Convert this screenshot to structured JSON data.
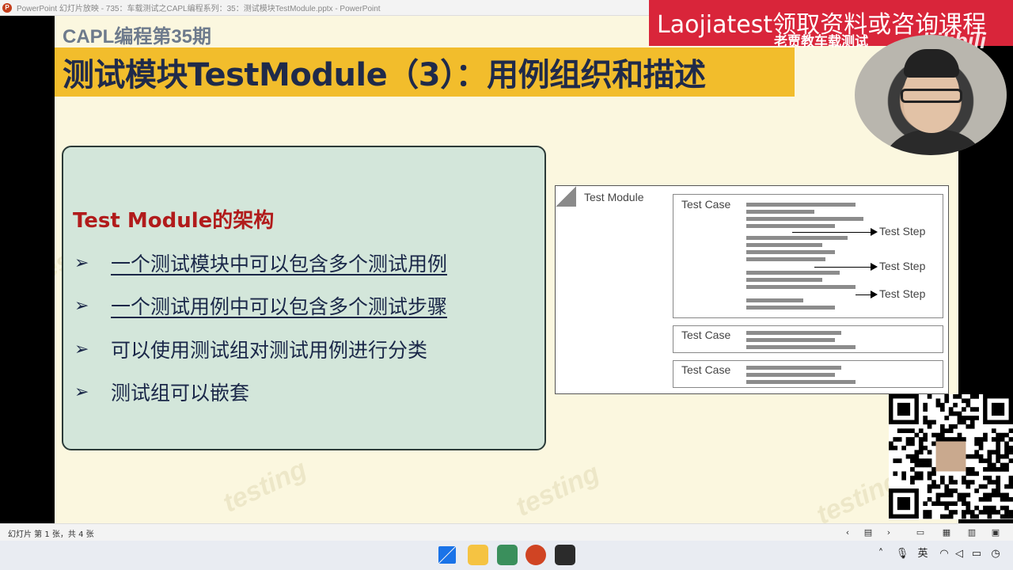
{
  "window": {
    "title": "PowerPoint 幻灯片放映 - 735：车载测试之CAPL编程系列：35：测试模块TestModule.pptx - PowerPoint"
  },
  "slide": {
    "subtitle": "CAPL编程第35期",
    "title": "测试模块TestModule（3）：用例组织和描述",
    "box_title": "Test Module的架构",
    "bullets": [
      "一个测试模块中可以包含多个测试用例",
      "一个测试用例中可以包含多个测试步骤",
      "可以使用测试组对测试用例进行分类",
      "测试组可以嵌套"
    ],
    "bullet_marker": "➢",
    "watermark": "testing"
  },
  "diagram": {
    "module_label": "Test Module",
    "case_label": "Test Case",
    "step_label": "Test Step"
  },
  "overlay": {
    "promo_text": "Laojiatest领取资料或咨询课程",
    "channel_text": "老贾教车载测试",
    "bilibili_text": "bilibili"
  },
  "statusbar": {
    "slide_info": "幻灯片 第 1 张，共 4 张",
    "prev_icon": "chevron-left-icon",
    "next_icon": "chevron-right-icon"
  },
  "taskbar": {
    "ime_label": "英"
  },
  "colors": {
    "title_bar": "#f2bd2c",
    "slide_bg": "#fbf7df",
    "box_bg": "#d3e6da",
    "box_title": "#b11b1b",
    "promo": "#d9253a"
  }
}
